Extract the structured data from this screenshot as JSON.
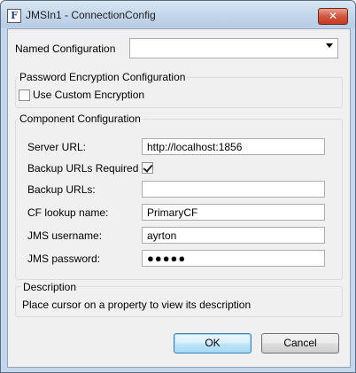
{
  "window": {
    "title": "JMSIn1 - ConnectionConfig",
    "icon_letter": "F",
    "close_glyph": "✕"
  },
  "named_configuration": {
    "label": "Named Configuration",
    "value": ""
  },
  "password_encryption": {
    "title": "Password Encryption Configuration",
    "use_custom_label": "Use Custom Encryption",
    "use_custom_checked": false
  },
  "component_configuration": {
    "title": "Component Configuration",
    "server_url_label": "Server URL:",
    "server_url_value": "http://localhost:1856",
    "backup_required_label": "Backup URLs Required",
    "backup_required_checked": true,
    "backup_urls_label": "Backup URLs:",
    "backup_urls_value": "",
    "cf_lookup_label": "CF lookup name:",
    "cf_lookup_value": "PrimaryCF",
    "jms_username_label": "JMS username:",
    "jms_username_value": "ayrton",
    "jms_password_label": "JMS password:",
    "jms_password_value": "●●●●●"
  },
  "description": {
    "title": "Description",
    "text": "Place cursor on a property to view its description"
  },
  "buttons": {
    "ok": "OK",
    "cancel": "Cancel"
  }
}
